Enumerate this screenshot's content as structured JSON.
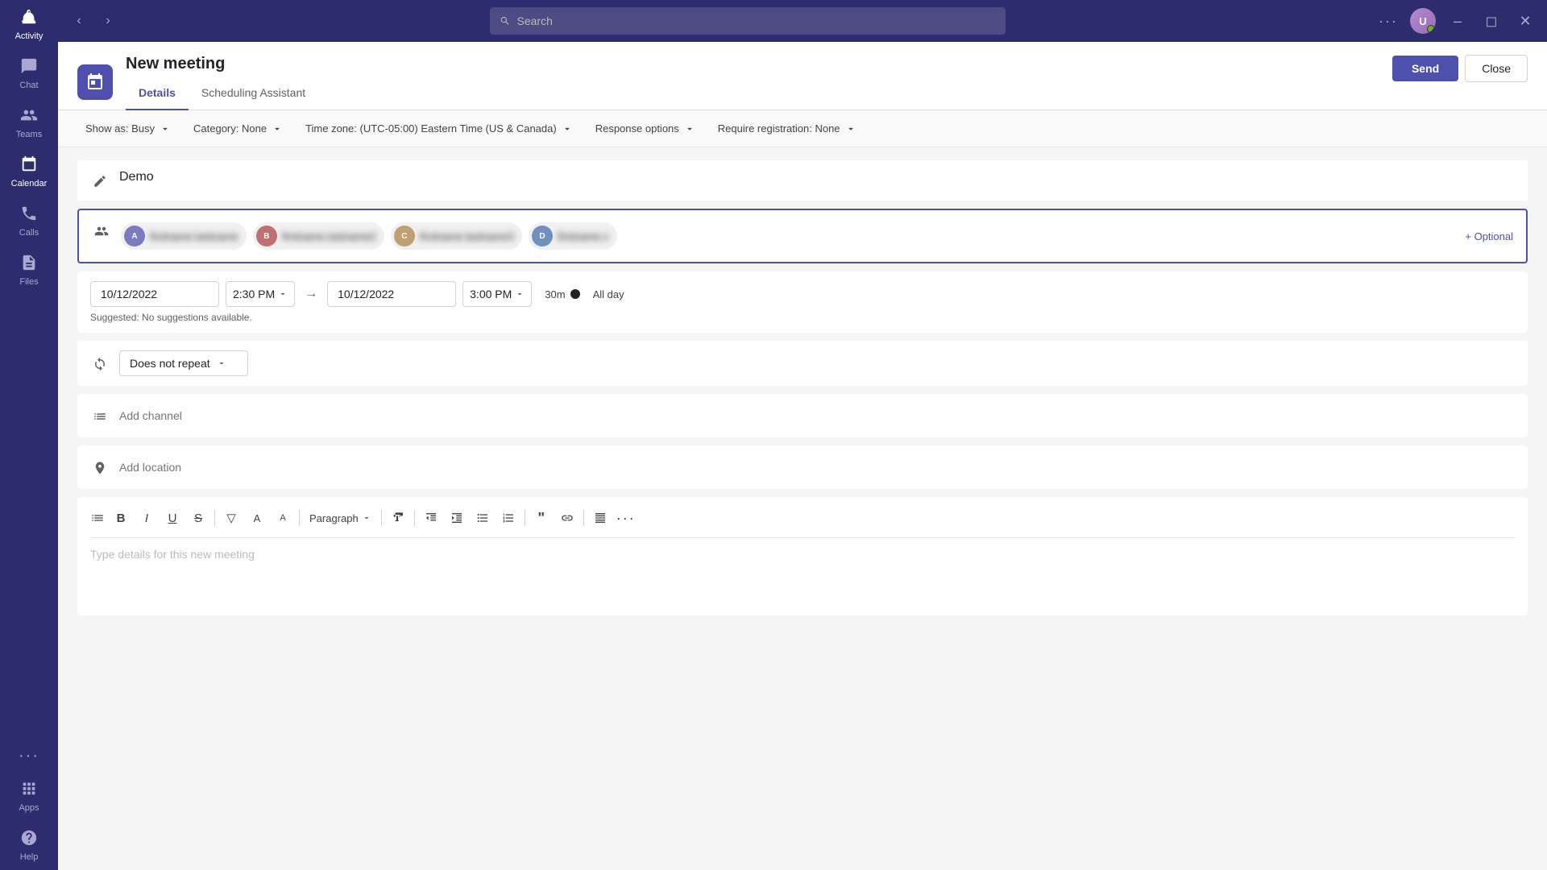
{
  "titlebar": {
    "search_placeholder": "Search",
    "nav_back": "‹",
    "nav_fwd": "›",
    "more_label": "···",
    "minimize": "—",
    "maximize": "□",
    "close": "✕"
  },
  "sidebar": {
    "items": [
      {
        "id": "activity",
        "label": "Activity",
        "icon": "🔔"
      },
      {
        "id": "chat",
        "label": "Chat",
        "icon": "💬"
      },
      {
        "id": "teams",
        "label": "Teams",
        "icon": "👥"
      },
      {
        "id": "calendar",
        "label": "Calendar",
        "icon": "📅",
        "active": true
      },
      {
        "id": "calls",
        "label": "Calls",
        "icon": "📞"
      },
      {
        "id": "files",
        "label": "Files",
        "icon": "📄"
      }
    ],
    "bottom_items": [
      {
        "id": "more",
        "label": "···",
        "icon": "···"
      },
      {
        "id": "apps",
        "label": "Apps",
        "icon": "⊞"
      },
      {
        "id": "help",
        "label": "Help",
        "icon": "?"
      }
    ]
  },
  "meeting": {
    "title": "New meeting",
    "icon_label": "📅",
    "tabs": [
      {
        "id": "details",
        "label": "Details",
        "active": true
      },
      {
        "id": "scheduling",
        "label": "Scheduling Assistant"
      }
    ],
    "send_label": "Send",
    "close_label": "Close"
  },
  "toolbar": {
    "show_as": "Show as: Busy",
    "category": "Category: None",
    "timezone": "Time zone: (UTC-05:00) Eastern Time (US & Canada)",
    "response_options": "Response options",
    "require_registration": "Require registration: None"
  },
  "form": {
    "title_value": "Demo",
    "title_placeholder": "New meeting",
    "attendees": [
      {
        "initials": "A",
        "color": "#7b7bc0",
        "name": "Attendee 1"
      },
      {
        "initials": "B",
        "color": "#c07070",
        "name": "Attendee 2"
      },
      {
        "initials": "C",
        "color": "#c0a070",
        "name": "Attendee 3"
      },
      {
        "initials": "D",
        "color": "#7090c0",
        "name": "Attendee 4"
      }
    ],
    "optional_label": "+ Optional",
    "start_date": "10/12/2022",
    "start_time": "2:30 PM",
    "end_date": "10/12/2022",
    "end_time": "3:00 PM",
    "duration": "30m",
    "all_day_label": "All day",
    "suggested_label": "Suggested: No suggestions available.",
    "repeat_label": "Does not repeat",
    "channel_placeholder": "Add channel",
    "location_placeholder": "Add location",
    "editor_placeholder": "Type details for this new meeting",
    "paragraph_label": "Paragraph",
    "editor_buttons": [
      "B",
      "I",
      "U",
      "S",
      "▽",
      "A",
      "A"
    ],
    "align_buttons": [
      "⇐",
      "⇒",
      "≡",
      "#",
      "❝",
      "🔗",
      "≡",
      "···"
    ]
  }
}
